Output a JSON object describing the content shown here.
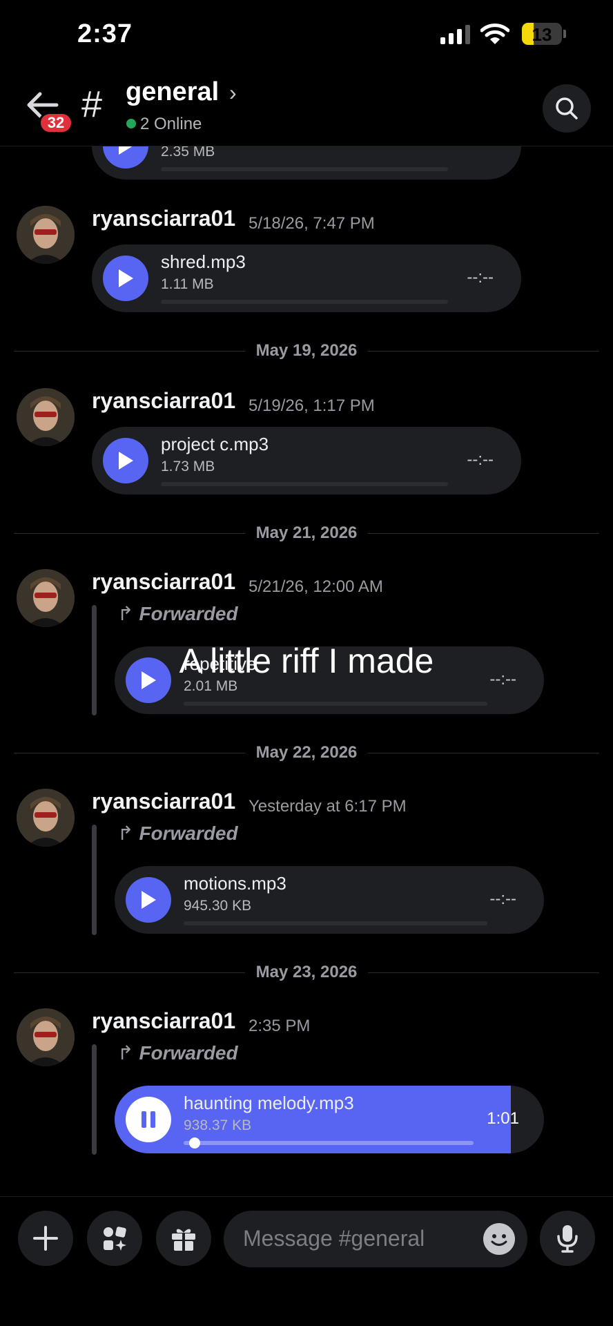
{
  "status": {
    "time": "2:37",
    "battery": "13"
  },
  "header": {
    "badge": "32",
    "hash": "#",
    "channel": "general",
    "online": "2 Online"
  },
  "partial_attachment": {
    "size": "2.35 MB",
    "duration": "--:--"
  },
  "messages": [
    {
      "username": "ryansciarra01",
      "timestamp": "5/18/26, 7:47 PM",
      "file": "shred.mp3",
      "size": "1.11 MB",
      "duration": "--:--"
    },
    {
      "divider": "May 19, 2026",
      "username": "ryansciarra01",
      "timestamp": "5/19/26, 1:17 PM",
      "file": "project c.mp3",
      "size": "1.73 MB",
      "duration": "--:--"
    },
    {
      "divider": "May 21, 2026",
      "username": "ryansciarra01",
      "timestamp": "5/21/26, 12:00 AM",
      "forwarded": "Forwarded",
      "file": "repetitive",
      "size": "2.01 MB",
      "duration": "--:--"
    },
    {
      "divider": "May 22, 2026",
      "username": "ryansciarra01",
      "timestamp": "Yesterday at 6:17 PM",
      "forwarded": "Forwarded",
      "file": "motions.mp3",
      "size": "945.30 KB",
      "duration": "--:--"
    },
    {
      "divider": "May 23, 2026",
      "username": "ryansciarra01",
      "timestamp": "2:35 PM",
      "forwarded": "Forwarded",
      "file": "haunting melody.mp3",
      "size": "938.37 KB",
      "duration": "1:01",
      "playing": true,
      "progress": 0.02
    }
  ],
  "overlay_caption": "A little riff I made",
  "composer": {
    "placeholder": "Message #general"
  },
  "colors": {
    "accent": "#5865f2",
    "badge": "#e0303c",
    "online": "#23a55a",
    "battery": "#f5d90a"
  },
  "icons": [
    "back-arrow-icon",
    "search-icon",
    "play-icon",
    "pause-icon",
    "forward-icon",
    "plus-icon",
    "apps-icon",
    "gift-icon",
    "emoji-icon",
    "microphone-icon"
  ]
}
